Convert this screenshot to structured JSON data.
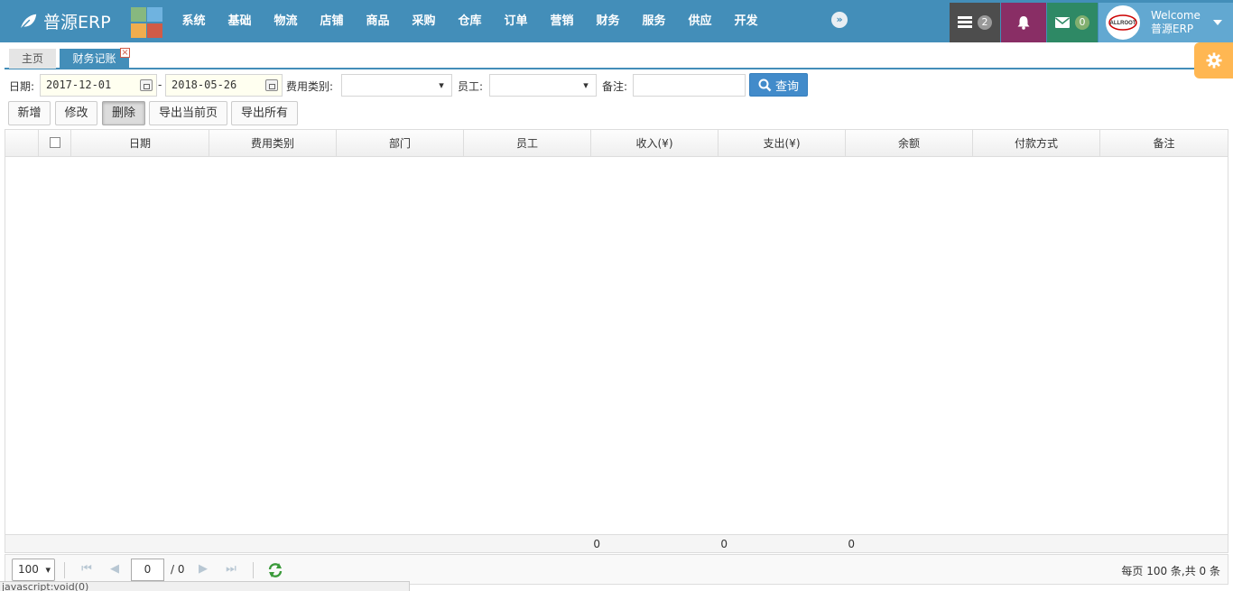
{
  "app": {
    "brand": "普源ERP"
  },
  "nav": {
    "menu": [
      "系统",
      "基础",
      "物流",
      "店铺",
      "商品",
      "采购",
      "仓库",
      "订单",
      "营销",
      "财务",
      "服务",
      "供应",
      "开发"
    ],
    "tasks_count": "2",
    "mail_count": "0",
    "welcome": "Welcome",
    "username": "普源ERP",
    "avatar_text": "ALLROOT"
  },
  "tabs": {
    "home": "主页",
    "active": "财务记账",
    "close_glyph": "×"
  },
  "filter": {
    "date_label": "日期:",
    "date_from": "2017-12-01",
    "date_sep": "-",
    "date_to": "2018-05-26",
    "fee_type_label": "费用类别:",
    "employee_label": "员工:",
    "remark_label": "备注:",
    "query_button": "查询"
  },
  "toolbar": {
    "add": "新增",
    "edit": "修改",
    "delete": "删除",
    "export_page": "导出当前页",
    "export_all": "导出所有"
  },
  "grid": {
    "columns": [
      "日期",
      "费用类别",
      "部门",
      "员工",
      "收入(¥)",
      "支出(¥)",
      "余额",
      "付款方式",
      "备注"
    ],
    "footer": {
      "income_total": "0",
      "expense_total": "0",
      "balance_total": "0"
    }
  },
  "pager": {
    "page_size": "100",
    "current_page": "0",
    "total_pages": "/ 0",
    "summary": "每页 100 条,共 0 条"
  },
  "status_bar": {
    "url": "javascript:void(0)"
  },
  "colors": {
    "navbar": "#438eb9",
    "tasks": "#4d4d4d",
    "notifications": "#892e65",
    "mail": "#2e8965",
    "user": "#62a8d1",
    "settings": "#ffb752",
    "query_button": "#428bca"
  }
}
